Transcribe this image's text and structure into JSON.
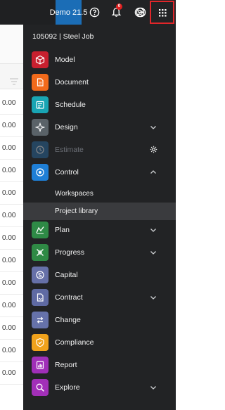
{
  "topbar": {
    "environment_label": "Demo 21.5",
    "notification_count": "0",
    "icons": [
      "help-icon",
      "bell-icon",
      "user-icon",
      "signout-icon",
      "apps-grid-icon"
    ]
  },
  "background": {
    "rows": [
      "0.00",
      "0.00",
      "0.00",
      "0.00",
      "0.00",
      "0.00",
      "0.00",
      "0.00",
      "0.00",
      "0.00",
      "0.00",
      "0.00",
      "0.00"
    ]
  },
  "menu": {
    "title": "105092 | Steel Job",
    "items": [
      {
        "label": "Model",
        "color": "#c8202f",
        "icon": "model-icon"
      },
      {
        "label": "Document",
        "color": "#f26a1b",
        "icon": "document-icon"
      },
      {
        "label": "Schedule",
        "color": "#19a5b4",
        "icon": "schedule-icon"
      },
      {
        "label": "Design",
        "color": "#5a6268",
        "icon": "design-icon",
        "chevron": "down"
      },
      {
        "label": "Estimate",
        "color": "#2a6fa8",
        "icon": "estimate-icon",
        "disabled": true,
        "trailing": "gear"
      },
      {
        "label": "Control",
        "color": "#1f7fd6",
        "icon": "control-icon",
        "chevron": "up"
      },
      {
        "label": "Plan",
        "color": "#2e8a46",
        "icon": "plan-icon",
        "chevron": "down"
      },
      {
        "label": "Progress",
        "color": "#2f8a45",
        "icon": "progress-icon",
        "chevron": "down"
      },
      {
        "label": "Capital",
        "color": "#6670a8",
        "icon": "capital-icon"
      },
      {
        "label": "Contract",
        "color": "#5f6aa3",
        "icon": "contract-icon",
        "chevron": "down"
      },
      {
        "label": "Change",
        "color": "#6672aa",
        "icon": "change-icon"
      },
      {
        "label": "Compliance",
        "color": "#f0a21c",
        "icon": "compliance-icon"
      },
      {
        "label": "Report",
        "color": "#a02fb8",
        "icon": "report-icon"
      },
      {
        "label": "Explore",
        "color": "#a22fb8",
        "icon": "explore-icon",
        "chevron": "down"
      }
    ],
    "subitems": [
      {
        "label": "Workspaces"
      },
      {
        "label": "Project library"
      }
    ]
  }
}
